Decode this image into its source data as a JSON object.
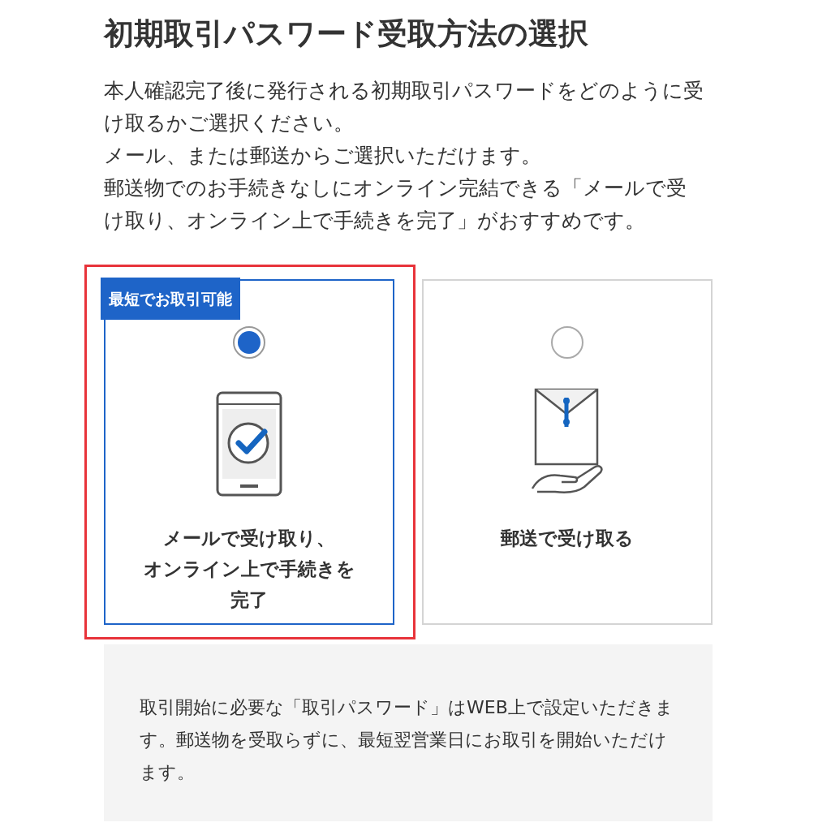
{
  "title": "初期取引パスワード受取方法の選択",
  "intro": [
    "本人確認完了後に発行される初期取引パスワードをどのように受け取るかご選択ください。",
    "メール、または郵送からご選択いただけます。",
    "郵送物でのお手続きなしにオンライン完結できる「メールで受け取り、オンライン上で手続きを完了」がおすすめです。"
  ],
  "options": [
    {
      "kind": "email",
      "badge": "最短でお取引可能",
      "selected": true,
      "highlighted": true,
      "label_lines": [
        "メールで受け取り、",
        "オンライン上で手続きを",
        "完了"
      ]
    },
    {
      "kind": "mail",
      "selected": false,
      "highlighted": false,
      "label_lines": [
        "郵送で受け取る"
      ]
    }
  ],
  "info": "取引開始に必要な「取引パスワード」はWEB上で設定いただきます。郵送物を受取らずに、最短翌営業日にお取引を開始いただけます。"
}
